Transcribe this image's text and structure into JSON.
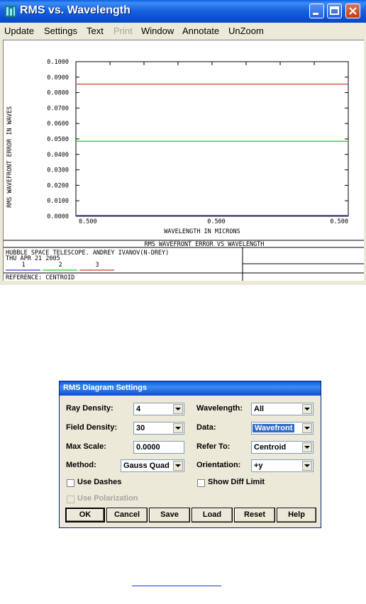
{
  "window": {
    "title": "RMS vs. Wavelength"
  },
  "menu": {
    "items": [
      {
        "label": "Update",
        "disabled": false
      },
      {
        "label": "Settings",
        "disabled": false
      },
      {
        "label": "Text",
        "disabled": false
      },
      {
        "label": "Print",
        "disabled": true
      },
      {
        "label": "Window",
        "disabled": false
      },
      {
        "label": "Annotate",
        "disabled": false
      },
      {
        "label": "UnZoom",
        "disabled": false
      }
    ]
  },
  "plot": {
    "ylabel": "RMS WAVEFRONT ERROR IN WAVES",
    "xlabel": "WAVELENGTH IN MICRONS",
    "caption": "RMS WAVEFRONT ERROR VS WAVELENGTH",
    "y_ticks": [
      "0.1000",
      "0.0900",
      "0.0800",
      "0.0700",
      "0.0600",
      "0.0500",
      "0.0400",
      "0.0300",
      "0.0200",
      "0.0100",
      "0.0000"
    ],
    "x_ticks": [
      "0.500",
      "0.500",
      "0.500"
    ],
    "colors": {
      "series1": "#3a3ad8",
      "series2": "#2cc02c",
      "series3": "#d03a2a"
    },
    "series": [
      {
        "label": "1",
        "value": 0.0
      },
      {
        "label": "2",
        "value": 0.0485
      },
      {
        "label": "3",
        "value": 0.0855
      }
    ],
    "ylim": [
      0,
      0.1
    ]
  },
  "info": {
    "line1": "HUBBLE SPACE TELESCOPE. ANDREY IVANOV(N-DREY)",
    "line2": "THU APR 21 2005",
    "reference": "REFERENCE: CENTROID"
  },
  "dialog": {
    "title": "RMS Diagram Settings",
    "ray_density": {
      "label": "Ray Density:",
      "value": "4"
    },
    "field_density": {
      "label": "Field Density:",
      "value": "30"
    },
    "max_scale": {
      "label": "Max Scale:",
      "value": "0.0000"
    },
    "method": {
      "label": "Method:",
      "value": "Gauss Quad"
    },
    "wavelength": {
      "label": "Wavelength:",
      "value": "All"
    },
    "data": {
      "label": "Data:",
      "value": "Wavefront"
    },
    "refer_to": {
      "label": "Refer To:",
      "value": "Centroid"
    },
    "orientation": {
      "label": "Orientation:",
      "value": "+y"
    },
    "use_dashes": "Use Dashes",
    "show_diff_limit": "Show Diff Limit",
    "use_polarization": "Use Polarization",
    "buttons": {
      "ok": "OK",
      "cancel": "Cancel",
      "save": "Save",
      "load": "Load",
      "reset": "Reset",
      "help": "Help"
    }
  }
}
